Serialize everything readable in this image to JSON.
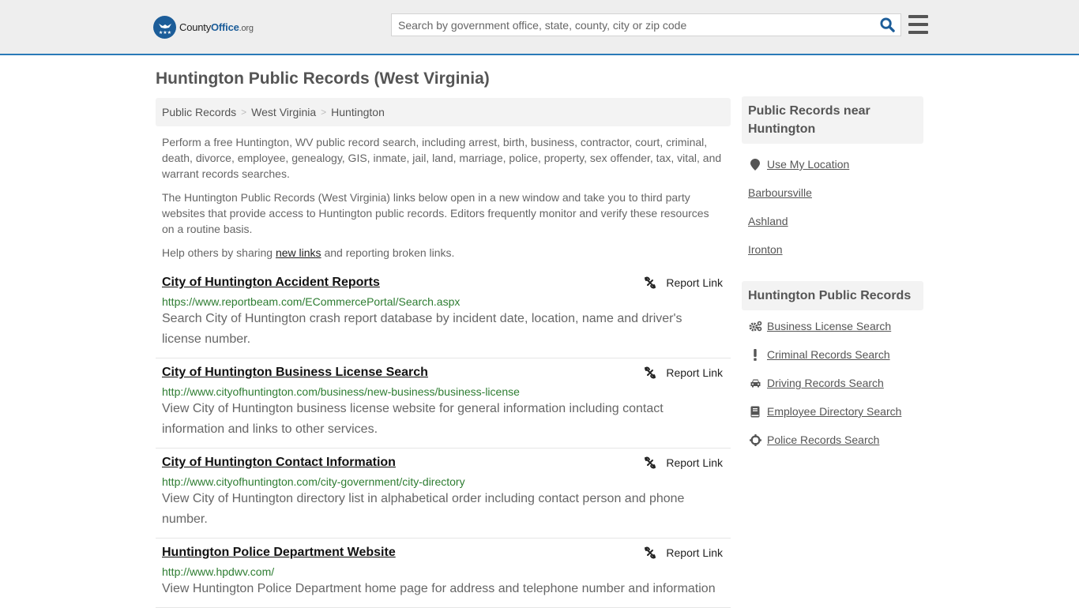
{
  "header": {
    "logo": {
      "brand_part1": "County",
      "brand_part2": "Office",
      "brand_suffix": ".org"
    },
    "search": {
      "placeholder": "Search by government office, state, county, city or zip code",
      "value": ""
    },
    "accent_color": "#2a7ab8"
  },
  "page_title": "Huntington Public Records (West Virginia)",
  "breadcrumb": [
    {
      "label": "Public Records"
    },
    {
      "label": "West Virginia"
    },
    {
      "label": "Huntington"
    }
  ],
  "intro": {
    "p1": "Perform a free Huntington, WV public record search, including arrest, birth, business, contractor, court, criminal, death, divorce, employee, genealogy, GIS, inmate, jail, land, marriage, police, property, sex offender, tax, vital, and warrant records searches.",
    "p2": "The Huntington Public Records (West Virginia) links below open in a new window and take you to third party websites that provide access to Huntington public records. Editors frequently monitor and verify these resources on a routine basis.",
    "p3_before": "Help others by sharing ",
    "p3_link": "new links",
    "p3_after": " and reporting broken links."
  },
  "entries": [
    {
      "title": "City of Huntington Accident Reports",
      "url": "https://www.reportbeam.com/ECommercePortal/Search.aspx",
      "description": "Search City of Huntington crash report database by incident date, location, name and driver's license number.",
      "report_label": "Report Link"
    },
    {
      "title": "City of Huntington Business License Search",
      "url": "http://www.cityofhuntington.com/business/new-business/business-license",
      "description": "View City of Huntington business license website for general information including contact information and links to other services.",
      "report_label": "Report Link"
    },
    {
      "title": "City of Huntington Contact Information",
      "url": "http://www.cityofhuntington.com/city-government/city-directory",
      "description": "View City of Huntington directory list in alphabetical order including contact person and phone number.",
      "report_label": "Report Link"
    },
    {
      "title": "Huntington Police Department Website",
      "url": "http://www.hpdwv.com/",
      "description": "View Huntington Police Department home page for address and telephone number and information",
      "report_label": "Report Link"
    }
  ],
  "sidebar": {
    "nearby": {
      "heading": "Public Records near Huntington",
      "use_location": {
        "label": "Use My Location",
        "icon": "map-marker-icon"
      },
      "places": [
        {
          "label": "Barboursville"
        },
        {
          "label": "Ashland"
        },
        {
          "label": "Ironton"
        }
      ]
    },
    "records": {
      "heading": "Huntington Public Records",
      "items": [
        {
          "label": "Business License Search",
          "icon": "gears-icon"
        },
        {
          "label": "Criminal Records Search",
          "icon": "exclamation-icon"
        },
        {
          "label": "Driving Records Search",
          "icon": "car-icon"
        },
        {
          "label": "Employee Directory Search",
          "icon": "book-icon"
        },
        {
          "label": "Police Records Search",
          "icon": "crosshairs-icon"
        }
      ]
    }
  }
}
